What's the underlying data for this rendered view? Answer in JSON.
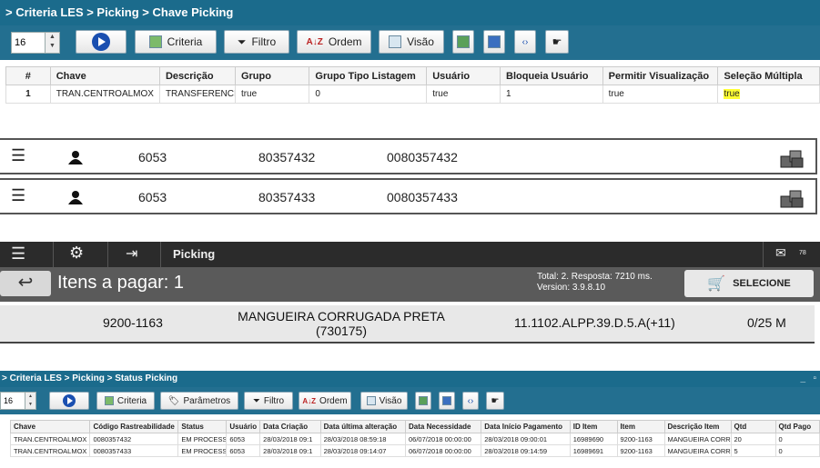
{
  "panel1": {
    "breadcrumb": "> Criteria LES > Picking > Chave Picking",
    "page_size": "16",
    "buttons": {
      "criteria": "Criteria",
      "filtro": "Filtro",
      "ordem": "Ordem",
      "visao": "Visão"
    },
    "columns": [
      "#",
      "Chave",
      "Descrição",
      "Grupo",
      "Grupo Tipo Listagem",
      "Usuário",
      "Bloqueia Usuário",
      "Permitir Visualização",
      "Seleção Múltipla"
    ],
    "row": {
      "n": "1",
      "chave": "TRAN.CENTROALMOX",
      "descricao": "TRANSFERENCIA",
      "grupo": "true",
      "grupo_tipo": "0",
      "usuario": "true",
      "bloqueia": "1",
      "permitir": "true",
      "selecao": "true"
    }
  },
  "panel2": {
    "rows": [
      {
        "a": "6053",
        "b": "80357432",
        "c": "0080357432"
      },
      {
        "a": "6053",
        "b": "80357433",
        "c": "0080357433"
      }
    ]
  },
  "panel3": {
    "title": "Picking",
    "badge": "78",
    "items_label": "Itens a pagar: 1",
    "status_line1": "Total: 2. Resposta: 7210 ms.",
    "status_line2": "Version: 3.9.8.10",
    "select_button": "SELECIONE",
    "item": {
      "code": "9200-1163",
      "desc1": "MANGUEIRA CORRUGADA PRETA",
      "desc2": "(730175)",
      "location": "11.1102.ALPP.39.D.5.A(+11)",
      "qty": "0/25 M"
    }
  },
  "panel4": {
    "breadcrumb": "> Criteria LES > Picking > Status Picking",
    "page_size": "16",
    "buttons": {
      "criteria": "Criteria",
      "parametros": "Parâmetros",
      "filtro": "Filtro",
      "ordem": "Ordem",
      "visao": "Visão"
    },
    "columns": [
      "Chave",
      "Código Rastreabilidade",
      "Status",
      "Usuário",
      "Data Criação",
      "Data última alteração",
      "Data Necessidade",
      "Data Início Pagamento",
      "ID Item",
      "Item",
      "Descrição Item",
      "Qtd",
      "Qtd Pago"
    ],
    "rows": [
      [
        "TRAN.CENTROALMOX",
        "0080357432",
        "EM PROCESSO",
        "6053",
        "28/03/2018 09:1",
        "28/03/2018 08:59:18",
        "06/07/2018 00:00:00",
        "28/03/2018 09:00:01",
        "16989690",
        "9200-1163",
        "MANGUEIRA CORR",
        "20",
        "0"
      ],
      [
        "TRAN.CENTROALMOX",
        "0080357433",
        "EM PROCESSO",
        "6053",
        "28/03/2018 09:1",
        "28/03/2018 09:14:07",
        "06/07/2018 00:00:00",
        "28/03/2018 09:14:59",
        "16989691",
        "9200-1163",
        "MANGUEIRA CORR",
        "5",
        "0"
      ]
    ]
  }
}
